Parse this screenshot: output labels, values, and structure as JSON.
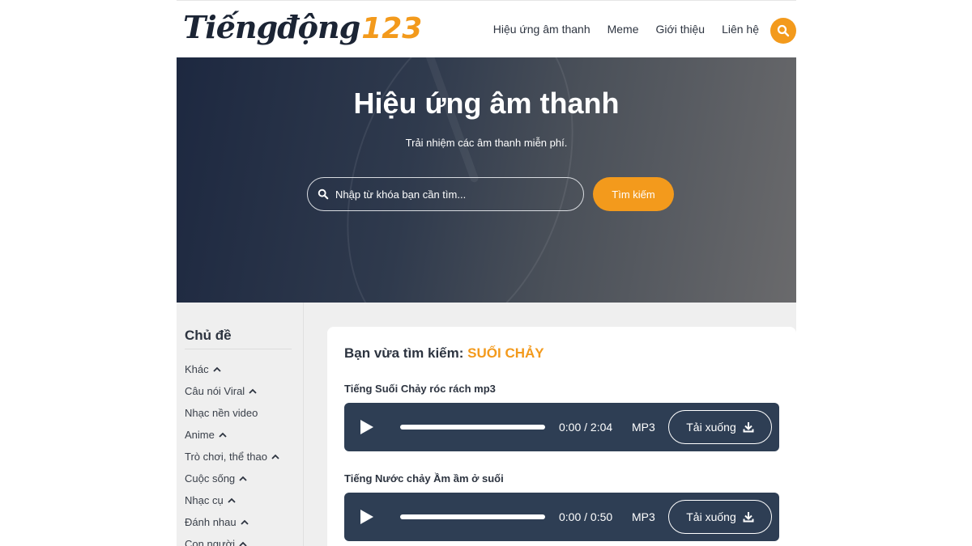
{
  "header": {
    "logo_main": "Tiếngđộng",
    "logo_num": "123",
    "nav": [
      "Hiệu ứng âm thanh",
      "Meme",
      "Giới thiệu",
      "Liên hệ"
    ]
  },
  "hero": {
    "title": "Hiệu ứng âm thanh",
    "subtitle": "Trải nhiệm các âm thanh miễn phí.",
    "search_placeholder": "Nhập từ khóa bạn cần tìm...",
    "search_button": "Tìm kiếm"
  },
  "sidebar": {
    "title": "Chủ đề",
    "items": [
      {
        "label": "Khác",
        "chevron": true
      },
      {
        "label": "Câu nói Viral",
        "chevron": true
      },
      {
        "label": "Nhạc nền video",
        "chevron": false
      },
      {
        "label": "Anime",
        "chevron": true
      },
      {
        "label": "Trò chơi, thể thao",
        "chevron": true
      },
      {
        "label": "Cuộc sống",
        "chevron": true
      },
      {
        "label": "Nhạc cụ",
        "chevron": true
      },
      {
        "label": "Đánh nhau",
        "chevron": true
      },
      {
        "label": "Con người",
        "chevron": true
      }
    ]
  },
  "results": {
    "heading_prefix": "Bạn vừa tìm kiếm:",
    "keyword": "SUỐI CHẢY",
    "items": [
      {
        "title": "Tiếng Suối Chảy róc rách mp3",
        "time": "0:00 / 2:04",
        "format": "MP3",
        "download": "Tải xuống"
      },
      {
        "title": "Tiếng Nước chảy Ầm ầm ở suối",
        "time": "0:00 / 0:50",
        "format": "MP3",
        "download": "Tải xuống"
      }
    ]
  },
  "colors": {
    "accent": "#f39a1c",
    "player_bg": "#2e3e54",
    "text_dark": "#2d3440"
  },
  "icons": [
    "search-icon",
    "chevron-up-icon",
    "play-icon",
    "download-icon"
  ]
}
